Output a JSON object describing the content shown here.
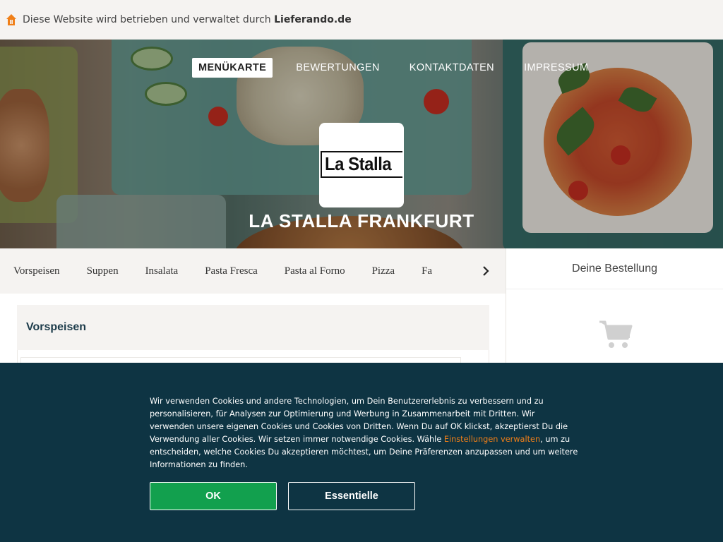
{
  "topbar": {
    "notice_prefix": "Diese Website wird betrieben und verwaltet durch ",
    "notice_brand": "Lieferando.de",
    "icon": "house-icon",
    "icon_color": "#f07f18"
  },
  "nav": {
    "items": [
      {
        "label": "MENÜKARTE",
        "active": true
      },
      {
        "label": "BEWERTUNGEN",
        "active": false
      },
      {
        "label": "KONTAKTDATEN",
        "active": false
      },
      {
        "label": "IMPRESSUM",
        "active": false
      }
    ]
  },
  "restaurant": {
    "logo_text": "La Stalla",
    "name": "LA STALLA FRANKFURT"
  },
  "categories": {
    "items": [
      "Vorspeisen",
      "Suppen",
      "Insalata",
      "Pasta Fresca",
      "Pasta al Forno",
      "Pizza",
      "Fa"
    ],
    "next_icon": "chevron-right-icon"
  },
  "menu": {
    "section_title": "Vorspeisen"
  },
  "order": {
    "title": "Deine Bestellung",
    "empty_icon": "cart-icon"
  },
  "cookie": {
    "text_before_link": "Wir verwenden Cookies und andere Technologien, um Dein Benutzererlebnis zu verbessern und zu personalisieren, für Analysen zur Optimierung und Werbung in Zusammenarbeit mit Dritten. Wir verwenden unsere eigenen Cookies und Cookies von Dritten. Wenn Du auf OK klickst, akzeptierst Du die Verwendung aller Cookies. Wir setzen immer notwendige Cookies. Wähle ",
    "link": "Einstellungen verwalten",
    "text_after_link": ", um zu entscheiden, welche Cookies Du akzeptieren möchtest, um Deine Präferenzen anzupassen und um weitere Informationen zu finden.",
    "ok_label": "OK",
    "essential_label": "Essentielle",
    "colors": {
      "background": "#0e3443",
      "ok": "#12a04e",
      "link": "#f07f18"
    }
  }
}
